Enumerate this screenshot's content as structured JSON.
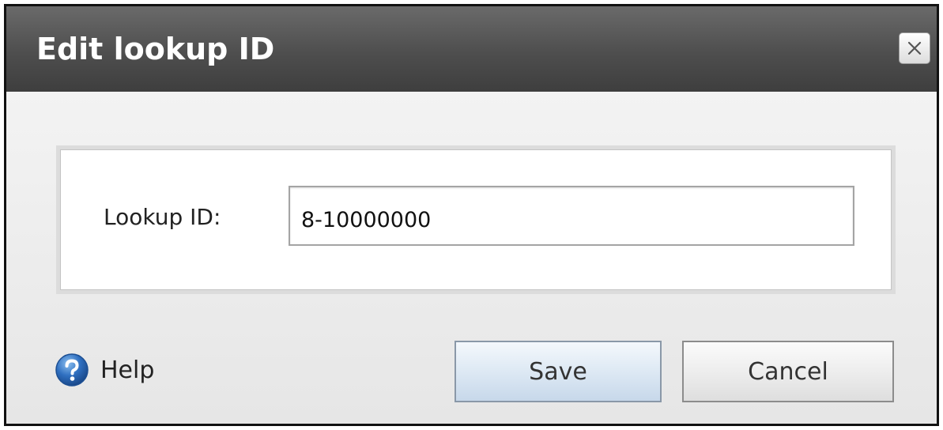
{
  "dialog": {
    "title": "Edit lookup ID",
    "close_icon": "close-icon"
  },
  "form": {
    "lookup_id_label": "Lookup ID:",
    "lookup_id_value": "8-10000000"
  },
  "footer": {
    "help_icon": "help-icon",
    "help_label": "Help",
    "save_label": "Save",
    "cancel_label": "Cancel"
  },
  "colors": {
    "titlebar": "#4e4e4e",
    "title_text": "#ffffff",
    "save_button": "#dbe7f3",
    "help_icon": "#2f6fc0"
  }
}
